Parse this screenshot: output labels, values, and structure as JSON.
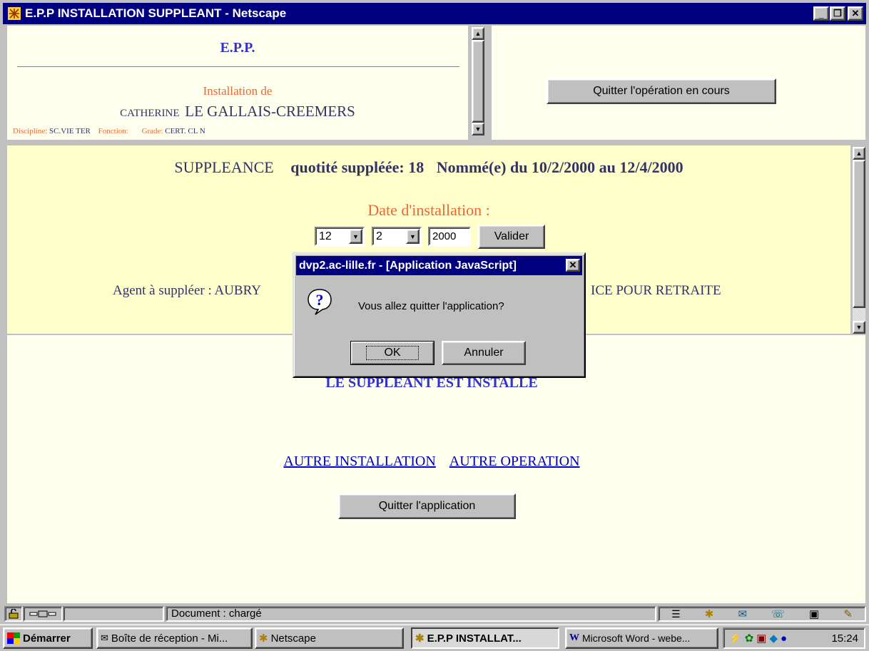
{
  "window": {
    "title": "E.P.P INSTALLATION SUPPLEANT - Netscape",
    "minimize_glyph": "_",
    "restore_glyph": "❐",
    "close_glyph": "✕"
  },
  "top_frame": {
    "heading": "E.P.P.",
    "installation_label": "Installation de",
    "first_name": "CATHERINE",
    "last_name": "LE GALLAIS-CREEMERS",
    "discipline_label": "Discipline:",
    "discipline_value": "SC.VIE TER",
    "fonction_label": "Fonction:",
    "grade_label": "Grade:",
    "grade_value": "CERT. CL N"
  },
  "top_right_frame": {
    "quit_operation_label": "Quitter l'opération en cours"
  },
  "middle_frame": {
    "suppleance_label": "SUPPLEANCE",
    "quotite_text": "quotité suppléée: 18",
    "nomme_text": "Nommé(e) du 10/2/2000 au 12/4/2000",
    "date_label": "Date d'installation :",
    "day_value": "12",
    "month_value": "2",
    "year_value": "2000",
    "validate_label": "Valider",
    "agent_left": "Agent à suppléer : AUBRY",
    "agent_right": "ICE POUR RETRAITE"
  },
  "bottom_frame": {
    "installed_text": "LE SUPPLEANT EST INSTALLE",
    "other_install_link": "AUTRE INSTALLATION",
    "other_operation_link": "AUTRE OPERATION",
    "quit_app_label": "Quitter l'application"
  },
  "dialog": {
    "title": "dvp2.ac-lille.fr - [Application JavaScript]",
    "message": "Vous allez quitter l'application?",
    "ok_label": "OK",
    "cancel_label": "Annuler",
    "icon": "question-icon"
  },
  "statusbar": {
    "text": "Document : chargé"
  },
  "taskbar": {
    "start_label": "Démarrer",
    "tasks": [
      {
        "label": "Boîte de réception - Mi..."
      },
      {
        "label": "Netscape"
      },
      {
        "label": "E.P.P INSTALLAT..."
      },
      {
        "label": "Microsoft Word - webe..."
      }
    ],
    "clock": "15:24"
  },
  "colors": {
    "title_blue": "#000080",
    "frame_bg": "#ffffee",
    "middle_bg": "#ffffcc",
    "heading_blue": "#3333cc",
    "orange": "#ee6633",
    "slate": "#333366"
  }
}
